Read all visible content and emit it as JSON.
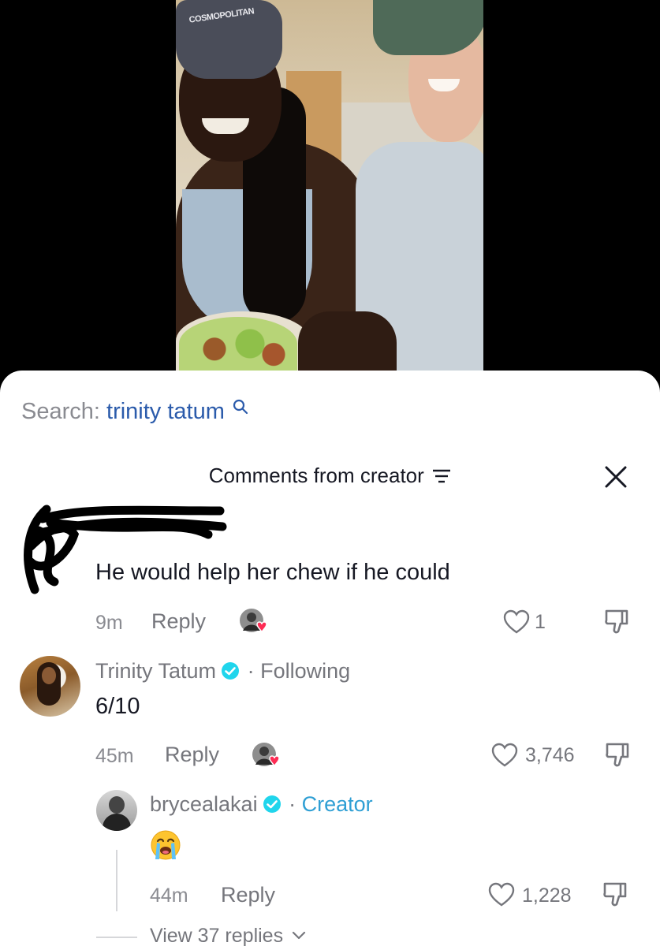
{
  "search": {
    "label": "Search:",
    "term": "trinity tatum"
  },
  "header": {
    "title": "Comments from creator"
  },
  "comments": [
    {
      "author_redacted": true,
      "text": "He would help her chew if he could",
      "time": "9m",
      "reply_label": "Reply",
      "likes": "1"
    },
    {
      "author": "Trinity Tatum",
      "verified": true,
      "separator": "·",
      "relation": "Following",
      "text": "6/10",
      "time": "45m",
      "reply_label": "Reply",
      "likes": "3,746",
      "replies": [
        {
          "author": "brycealakai",
          "verified": true,
          "separator": "·",
          "relation": "Creator",
          "emoji": "loudly-crying-face",
          "time": "44m",
          "reply_label": "Reply",
          "likes": "1,228"
        }
      ],
      "view_replies": "View 37 replies"
    }
  ],
  "video": {
    "cap_text": "COSMOPOLITAN"
  },
  "colors": {
    "search_term": "#2b5bab",
    "creator_badge": "#2f9fd4",
    "verified": "#20d5ec",
    "liked_heart": "#fe2c55"
  }
}
